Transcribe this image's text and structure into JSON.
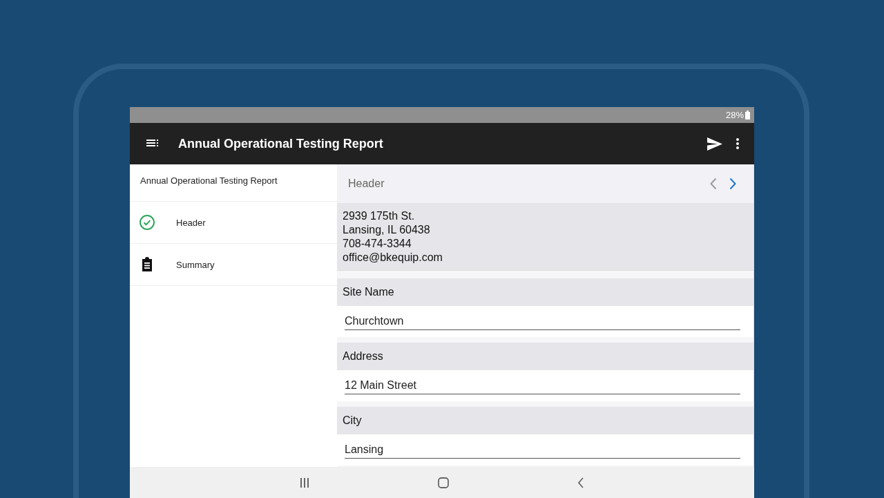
{
  "status_bar": {
    "battery": "28%"
  },
  "app_bar": {
    "title": "Annual Operational Testing Report"
  },
  "sidebar": {
    "title": "Annual Operational Testing Report",
    "items": [
      {
        "label": "Header",
        "kind": "complete"
      },
      {
        "label": "Summary",
        "kind": "form"
      }
    ]
  },
  "section": {
    "title": "Header",
    "previous": {
      "disabled": true
    },
    "next": {
      "disabled": false
    }
  },
  "company_info": [
    "2939 175th St.",
    "Lansing, IL 60438",
    "708-474-3344",
    "office@bkequip.com"
  ],
  "fields": [
    {
      "label": "Site Name",
      "value": "Churchtown"
    },
    {
      "label": "Address",
      "value": "12 Main Street"
    },
    {
      "label": "City",
      "value": "Lansing"
    }
  ]
}
